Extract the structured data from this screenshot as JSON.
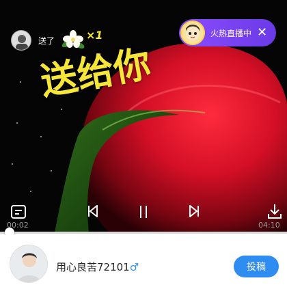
{
  "gift_notice": {
    "action_text": "送了",
    "count": "×1",
    "sender_avatar_icon": "user-avatar-icon",
    "gift_icon": "jasmine-flower-icon"
  },
  "video": {
    "overlay_text": "送给你",
    "current_time": "00:02",
    "total_time": "04:10",
    "progress": 0.008
  },
  "live_badge": {
    "label": "火热直播中",
    "avatar_icon": "streamer-avatar-icon",
    "close_icon": "close-icon"
  },
  "controls": {
    "subtitle_icon": "subtitle-icon",
    "prev_icon": "skip-previous-icon",
    "pause_icon": "pause-icon",
    "next_icon": "skip-next-icon",
    "download_icon": "download-icon"
  },
  "author": {
    "name": "用心良苦72101",
    "gender_symbol": "♂",
    "post_label": "投稿"
  },
  "colors": {
    "accent_blue": "#2f8cf1",
    "live_purple": "#7d45f2",
    "text_yellow": "#f6e63a"
  }
}
